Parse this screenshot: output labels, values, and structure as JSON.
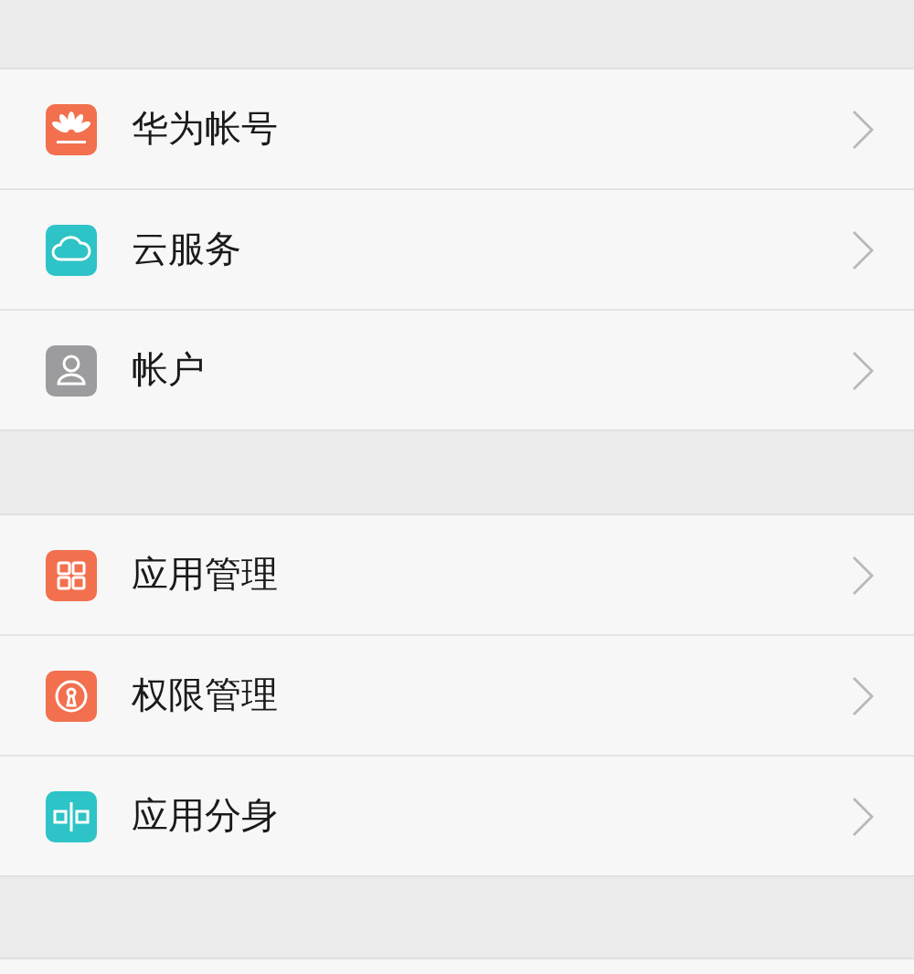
{
  "groups": [
    {
      "items": [
        {
          "label": "华为帐号",
          "kind": "petals",
          "color": "#f2704e"
        },
        {
          "label": "云服务",
          "kind": "cloud",
          "color": "#2ec3c6"
        },
        {
          "label": "帐户",
          "kind": "person",
          "color": "#9c9c9e"
        }
      ]
    },
    {
      "items": [
        {
          "label": "应用管理",
          "kind": "grid",
          "color": "#f2704e"
        },
        {
          "label": "权限管理",
          "kind": "keyhole",
          "color": "#f2704e"
        },
        {
          "label": "应用分身",
          "kind": "split",
          "color": "#2ec3c6"
        }
      ]
    }
  ]
}
